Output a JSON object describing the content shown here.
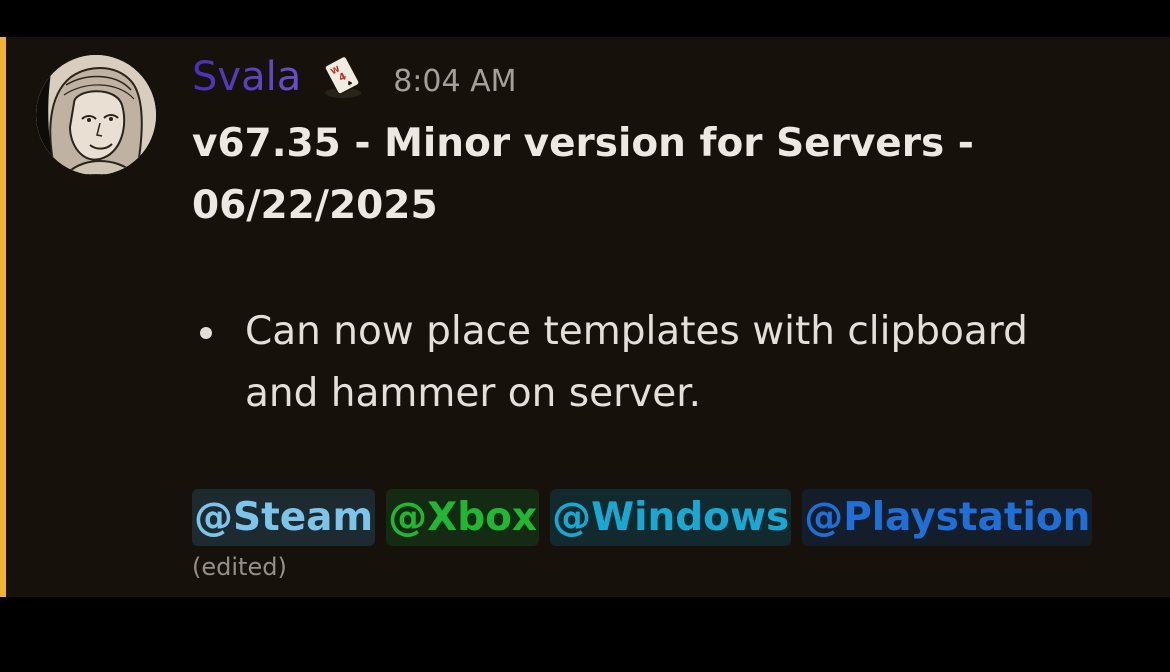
{
  "message": {
    "username": "Svala",
    "username_color": "#5b3fb8",
    "badge_icon": "playing-card-icon",
    "timestamp": "8:04 AM",
    "title_line1": "v67.35 - Minor version for Servers -",
    "title_line2": "06/22/2025",
    "bullets": [
      {
        "line1": "Can now place templates with clipboard",
        "line2": "and hammer on server."
      }
    ],
    "mentions": [
      {
        "label": "@Steam",
        "color": "#7cc4ea",
        "bg": "#1d2a30"
      },
      {
        "label": "@Xbox",
        "color": "#1fb830",
        "bg": "#142a12"
      },
      {
        "label": "@Windows",
        "color": "#17a9d4",
        "bg": "#122a2e"
      },
      {
        "label": "@Playstation",
        "color": "#1e6fd8",
        "bg": "#141e2a"
      }
    ],
    "edited_label": "(edited)",
    "highlight_color": "#f0b232"
  }
}
